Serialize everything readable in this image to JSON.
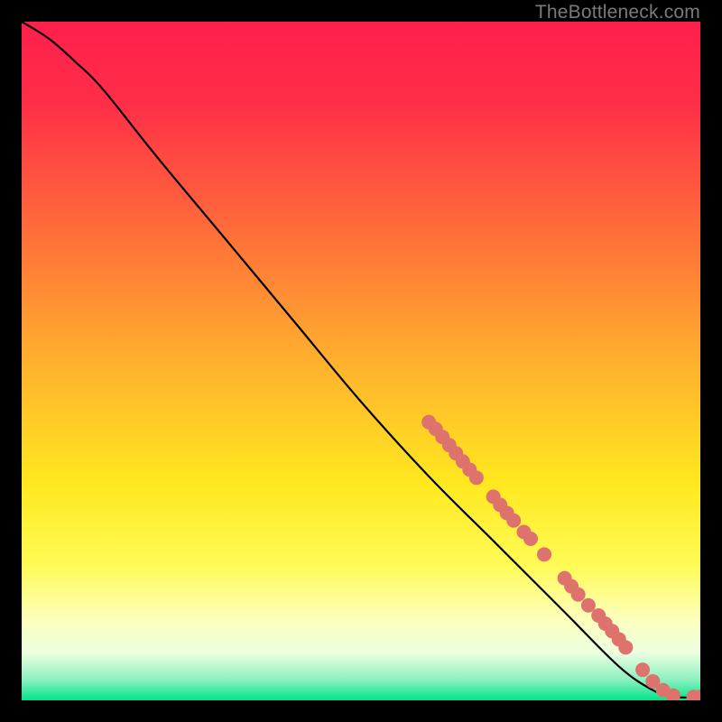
{
  "watermark": "TheBottleneck.com",
  "chart_data": {
    "type": "line",
    "title": "",
    "xlabel": "",
    "ylabel": "",
    "xlim": [
      0,
      100
    ],
    "ylim": [
      0,
      100
    ],
    "gradient_stops": [
      {
        "offset": 0.0,
        "color": "#ff1f4b"
      },
      {
        "offset": 0.12,
        "color": "#ff2e48"
      },
      {
        "offset": 0.3,
        "color": "#ff6a3a"
      },
      {
        "offset": 0.5,
        "color": "#ffb02e"
      },
      {
        "offset": 0.68,
        "color": "#ffe81f"
      },
      {
        "offset": 0.8,
        "color": "#fffb55"
      },
      {
        "offset": 0.88,
        "color": "#fdffbc"
      },
      {
        "offset": 0.93,
        "color": "#ecffe0"
      },
      {
        "offset": 0.97,
        "color": "#8af0c0"
      },
      {
        "offset": 1.0,
        "color": "#00e48a"
      }
    ],
    "curve": [
      {
        "x": 0.0,
        "y": 100.0
      },
      {
        "x": 4.0,
        "y": 97.5
      },
      {
        "x": 8.0,
        "y": 94.0
      },
      {
        "x": 12.0,
        "y": 90.0
      },
      {
        "x": 20.0,
        "y": 80.0
      },
      {
        "x": 30.0,
        "y": 68.0
      },
      {
        "x": 40.0,
        "y": 56.0
      },
      {
        "x": 50.0,
        "y": 44.0
      },
      {
        "x": 60.0,
        "y": 33.0
      },
      {
        "x": 70.0,
        "y": 23.0
      },
      {
        "x": 80.0,
        "y": 13.0
      },
      {
        "x": 88.0,
        "y": 5.0
      },
      {
        "x": 93.0,
        "y": 1.5
      },
      {
        "x": 96.0,
        "y": 0.5
      },
      {
        "x": 100.0,
        "y": 0.5
      }
    ],
    "markers": [
      {
        "x": 60.0,
        "y": 41.0
      },
      {
        "x": 61.0,
        "y": 40.0
      },
      {
        "x": 62.0,
        "y": 38.8
      },
      {
        "x": 63.0,
        "y": 37.6
      },
      {
        "x": 64.0,
        "y": 36.4
      },
      {
        "x": 65.0,
        "y": 35.2
      },
      {
        "x": 66.0,
        "y": 34.0
      },
      {
        "x": 67.0,
        "y": 32.8
      },
      {
        "x": 69.5,
        "y": 30.0
      },
      {
        "x": 70.5,
        "y": 28.8
      },
      {
        "x": 71.5,
        "y": 27.6
      },
      {
        "x": 72.5,
        "y": 26.5
      },
      {
        "x": 74.0,
        "y": 24.8
      },
      {
        "x": 75.0,
        "y": 23.8
      },
      {
        "x": 77.0,
        "y": 21.5
      },
      {
        "x": 80.0,
        "y": 18.0
      },
      {
        "x": 81.0,
        "y": 16.8
      },
      {
        "x": 82.0,
        "y": 15.6
      },
      {
        "x": 83.5,
        "y": 14.0
      },
      {
        "x": 85.0,
        "y": 12.5
      },
      {
        "x": 86.0,
        "y": 11.3
      },
      {
        "x": 87.0,
        "y": 10.2
      },
      {
        "x": 88.0,
        "y": 9.0
      },
      {
        "x": 89.0,
        "y": 7.8
      },
      {
        "x": 91.5,
        "y": 4.5
      },
      {
        "x": 93.0,
        "y": 2.8
      },
      {
        "x": 94.5,
        "y": 1.5
      },
      {
        "x": 96.0,
        "y": 0.7
      },
      {
        "x": 99.0,
        "y": 0.5
      },
      {
        "x": 100.0,
        "y": 0.5
      }
    ],
    "marker_color": "#de736d",
    "marker_radius": 8,
    "curve_color": "#000000",
    "curve_width": 2.2
  }
}
